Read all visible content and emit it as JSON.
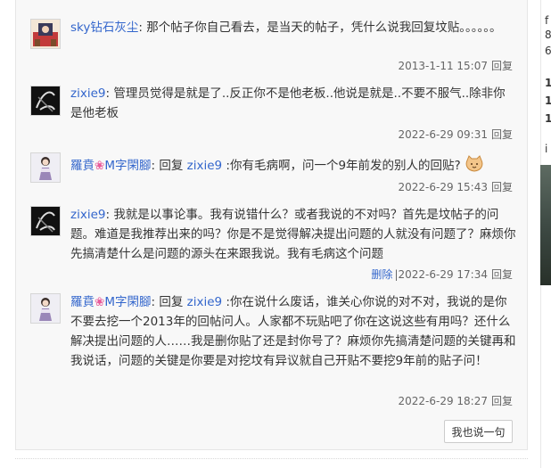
{
  "comments": [
    {
      "author": "sky钻石灰尘",
      "sep": ":",
      "text": "那个帖子你自己看去，是当天的帖子，凭什么说我回复坟贴。。。。。。",
      "time": "2013-1-11 15:07",
      "reply_label": "回复"
    },
    {
      "author": "zixie9",
      "sep": ":",
      "text": "管理员觉得是就是了..反正你不是他老板..他说是就是..不要不服气..除非你是他老板",
      "time": "2022-6-29 09:31",
      "reply_label": "回复"
    },
    {
      "author_pre": "羅賁",
      "author_flower": "❀",
      "author_post": "M字閑腳",
      "sep": ":",
      "reply_prefix": "回复",
      "reply_to": "zixie9",
      "text": ":你有毛病啊，问一个9年前发的别人的回贴?",
      "time": "2022-6-29 15:43",
      "reply_label": "回复"
    },
    {
      "author": "zixie9",
      "sep": ":",
      "text": "我就是以事论事。我有说错什么？或者我说的不对吗？首先是坟帖子的问题。难道是我推荐出来的吗？你是不是觉得解决提出问题的人就没有问题了？麻烦你先搞清楚什么是问题的源头在来跟我说。我有毛病这个问题",
      "delete_label": "删除",
      "time": "|2022-6-29 17:34",
      "reply_label": "回复"
    },
    {
      "author_pre": "羅賁",
      "author_flower": "❀",
      "author_post": "M字閑腳",
      "sep": ":",
      "reply_prefix": "回复",
      "reply_to": "zixie9",
      "text": ":你在说什么废话，谁关心你说的对不对，我说的是你不要去挖一个2013年的回帖问人。人家都不玩贴吧了你在这说这些有用吗？还什么解决提出问题的人……我是删你贴了还是封你号了？麻烦你先搞清楚问题的关键再和我说话，问题的关键是你要是对挖坟有异议就自己开贴不要挖9年前的贴子问！",
      "time": "2022-6-29 18:27",
      "reply_label": "回复"
    }
  ],
  "say_button_label": "我也说一句",
  "sidebar_fragments": [
    "f",
    "8",
    "6",
    "1",
    "1",
    "1",
    "i"
  ],
  "colors": {
    "link": "#3366cc",
    "panel_bg": "#f8f8f8",
    "meta": "#666666"
  },
  "icons": {
    "emoji": "cat-face-emoji-icon"
  }
}
